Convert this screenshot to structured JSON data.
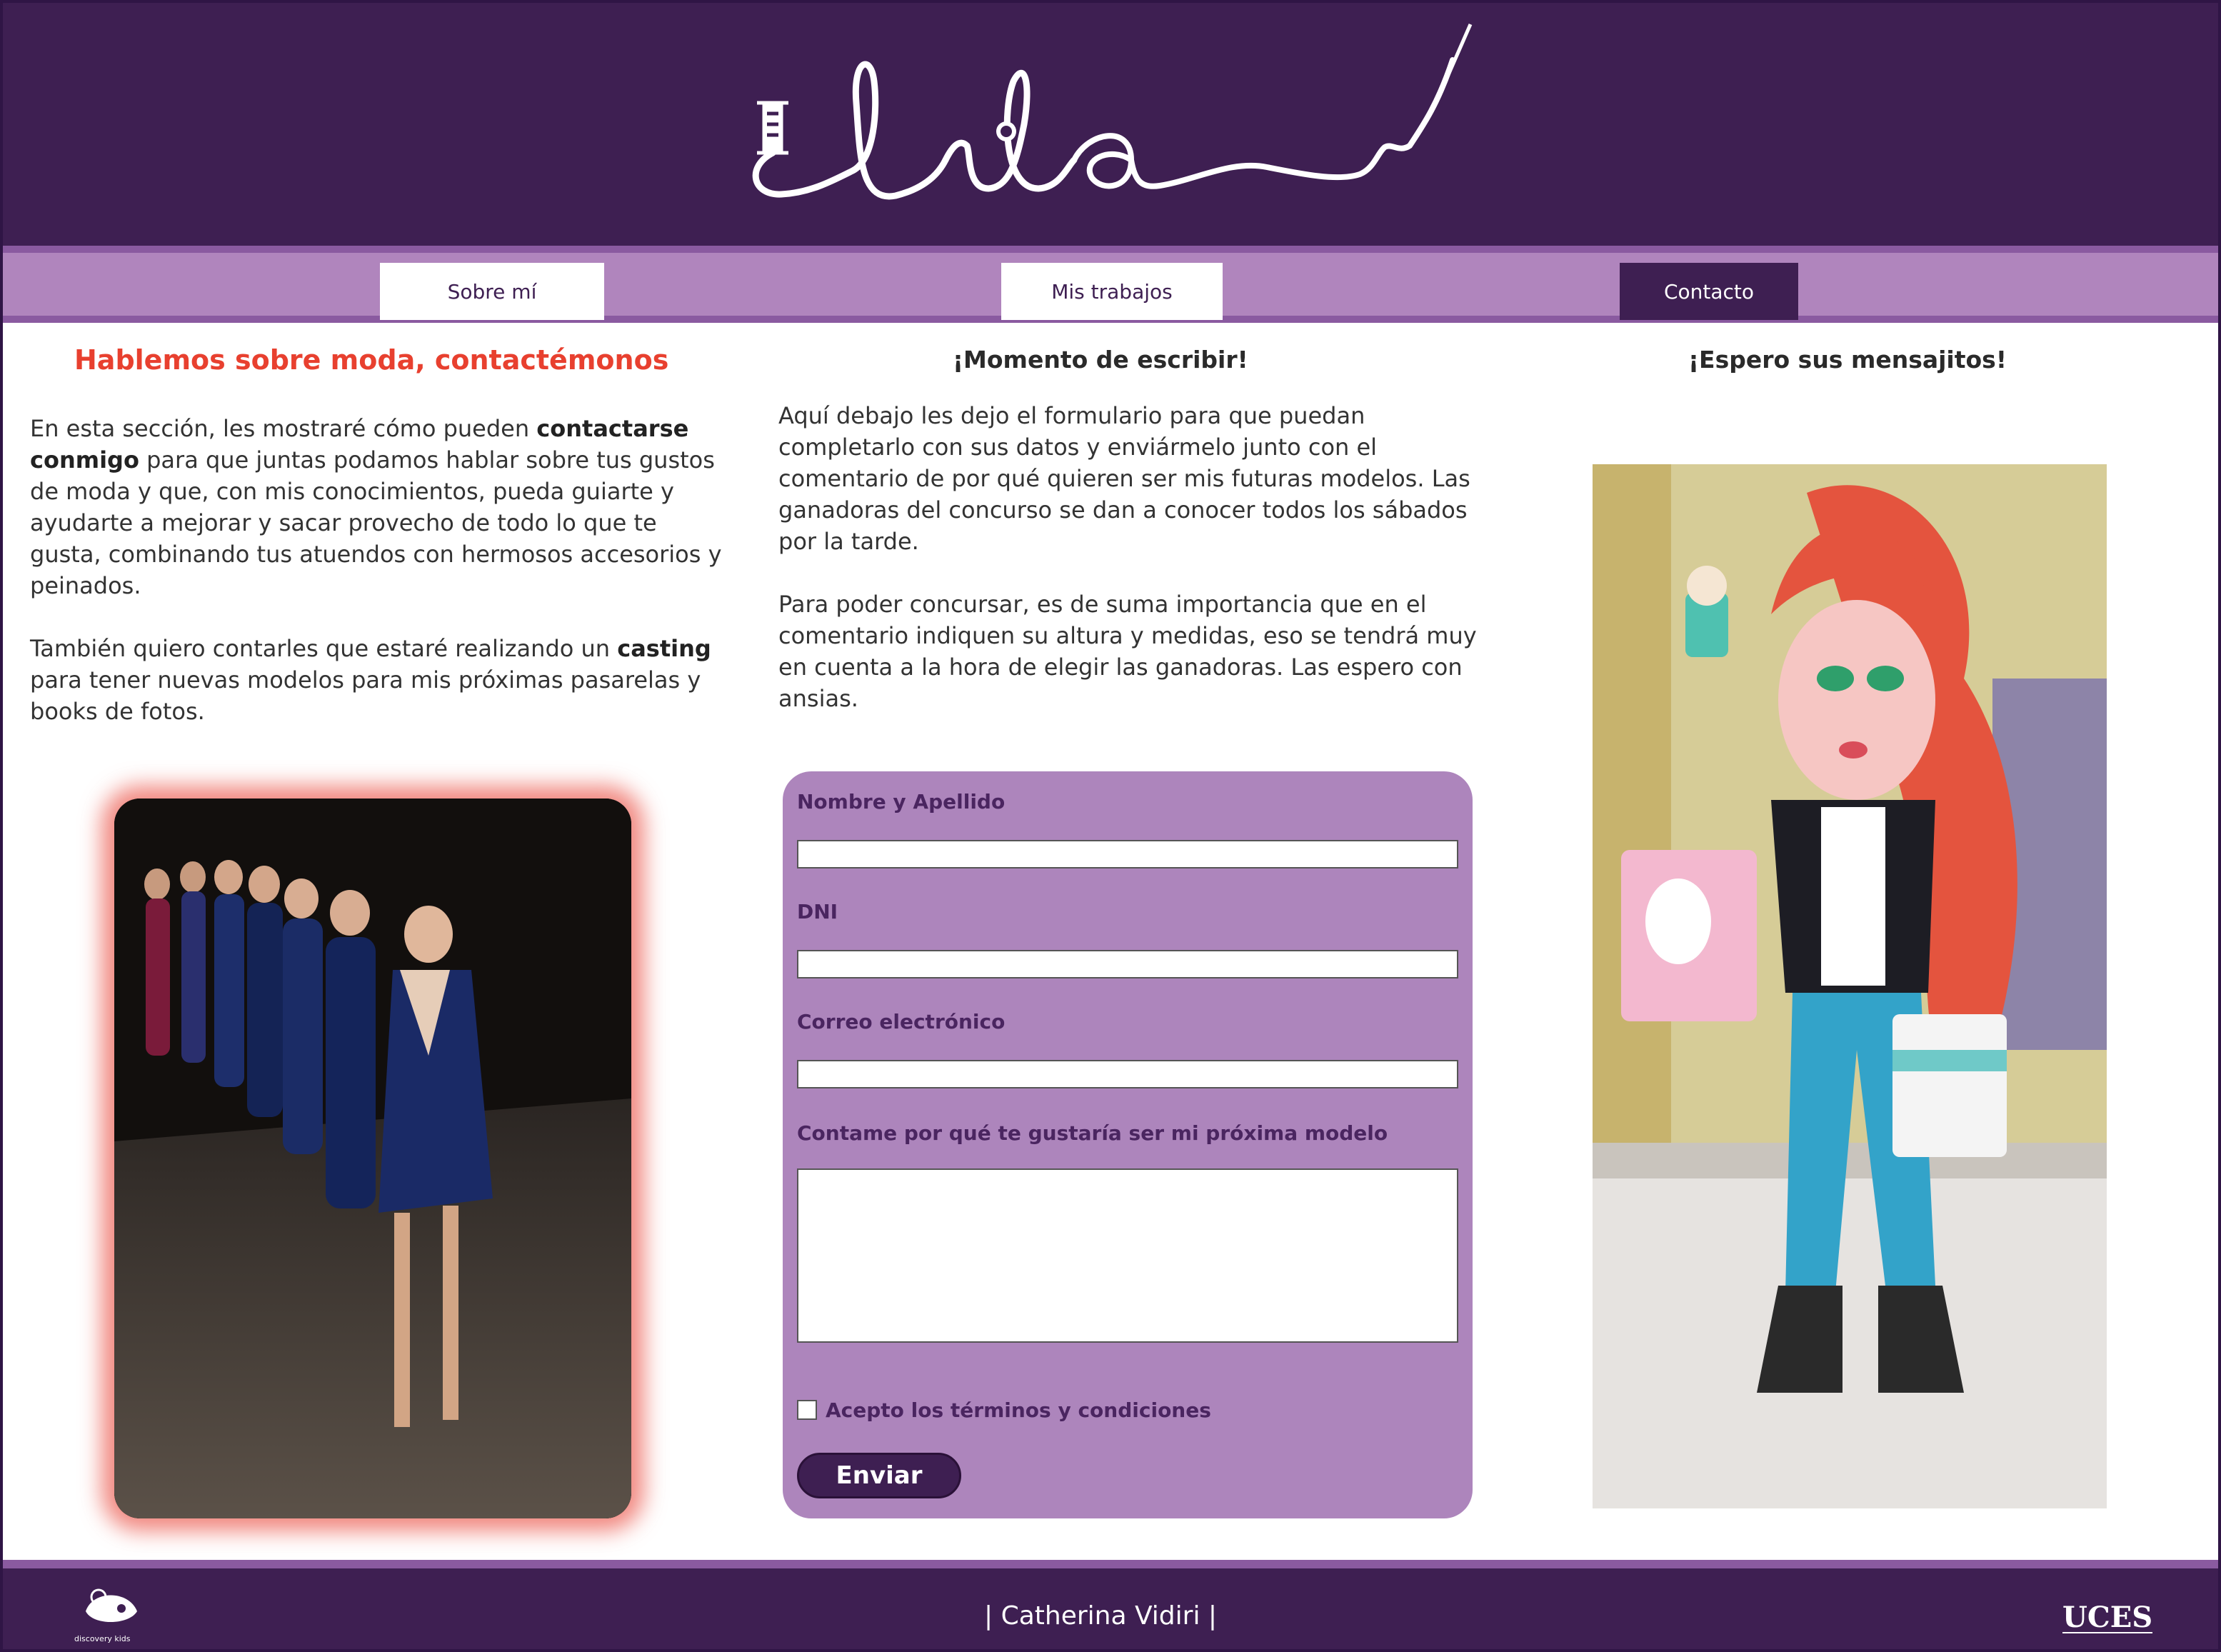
{
  "header": {
    "logo_text": "lila",
    "brand_color": "#3e1f52"
  },
  "nav": {
    "items": [
      {
        "label": "Sobre mí",
        "active": false
      },
      {
        "label": "Mis trabajos",
        "active": false
      },
      {
        "label": "Contacto",
        "active": true
      }
    ]
  },
  "left": {
    "heading": "Hablemos sobre moda, contactémonos",
    "p1_a": "En esta sección, les mostraré cómo pueden ",
    "p1_bold": "contactarse conmigo",
    "p1_b": " para que juntas podamos hablar sobre tus gustos de moda y que, con mis conocimientos, pueda guiarte y ayudarte a mejorar y sacar provecho de todo lo que te gusta, combinando tus atuendos con hermosos accesorios y peinados.",
    "p2_a": "También quiero contarles que estaré realizando un ",
    "p2_bold": "casting",
    "p2_b": " para tener nuevas modelos para mis próximas pasarelas y books de fotos.",
    "image_name": "runway-photo"
  },
  "middle": {
    "heading": "¡Momento de escribir!",
    "p1": "Aquí debajo les dejo el formulario para que puedan completarlo con sus datos y enviármelo junto con el comentario de por qué quieren ser mis futuras modelos. Las ganadoras del concurso se dan a conocer todos los sábados por la tarde.",
    "p2": "Para poder concursar, es de suma importancia que en el comentario indiquen su altura y medidas, eso se tendrá muy en cuenta a la hora de elegir las ganadoras. Las espero con ansias.",
    "form": {
      "name_label": "Nombre y Apellido",
      "name_value": "",
      "dni_label": "DNI",
      "dni_value": "",
      "email_label": "Correo electrónico",
      "email_value": "",
      "comment_label": "Contame por qué te gustaría ser mi próxima modelo",
      "comment_value": "",
      "terms_label": "Acepto los términos y condiciones",
      "terms_checked": false,
      "submit_label": "Enviar"
    }
  },
  "right": {
    "heading": "¡Espero sus mensajitos!",
    "image_name": "lila-cartoon"
  },
  "footer": {
    "author": "| Catherina Vidiri |",
    "left_logo_text": "discovery kids",
    "right_logo_text": "UCES"
  },
  "colors": {
    "accent": "#e8402f",
    "nav": "#b085bd",
    "form_bg": "#ad85bc",
    "dark_purple": "#3e1f52"
  }
}
